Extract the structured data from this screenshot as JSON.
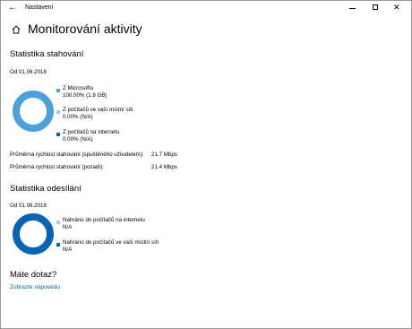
{
  "window": {
    "title": "Nastavení",
    "back_glyph": "←",
    "minimize_label": "minimize",
    "maximize_label": "maximize",
    "close_glyph": "✕"
  },
  "header": {
    "home_icon": "home-icon",
    "title": "Monitorování aktivity"
  },
  "download": {
    "title": "Statistika stahování",
    "date": "Od 01.06.2018",
    "legend": [
      {
        "label": "Z Microsoftu",
        "value": "100.00%  (1.8 GB)",
        "color": "#4ea0d9",
        "fraction": 1.0
      },
      {
        "label": "Z počítačů ve vaší místní síti",
        "value": "0.00%  (N/A)",
        "color": "#9fcbec",
        "fraction": 0.0
      },
      {
        "label": "Z počítačů na internetu",
        "value": "0.00%  (N/A)",
        "color": "#0b64b3",
        "fraction": 0.0
      }
    ],
    "avg_user_label": "Průměrná rychlost stahování (spuštěného uživatelem):",
    "avg_user_value": "21.7 Mbps",
    "avg_bg_label": "Průměrná rychlost stahování (pozadí):",
    "avg_bg_value": "21.4 Mbps"
  },
  "upload": {
    "title": "Statistika odesílání",
    "date": "Od 01.06.2018",
    "legend": [
      {
        "label": "Nahráno do počítačů na internetu",
        "value": "N/A",
        "color": "#9fcbec"
      },
      {
        "label": "Nahráno do počítačů ve vaší místní síti",
        "value": "N/A",
        "color": "#0b64b3"
      }
    ],
    "ring_color": "#0b64b3"
  },
  "help": {
    "title": "Máte dotaz?",
    "link": "Zobrazte nápovědu"
  }
}
